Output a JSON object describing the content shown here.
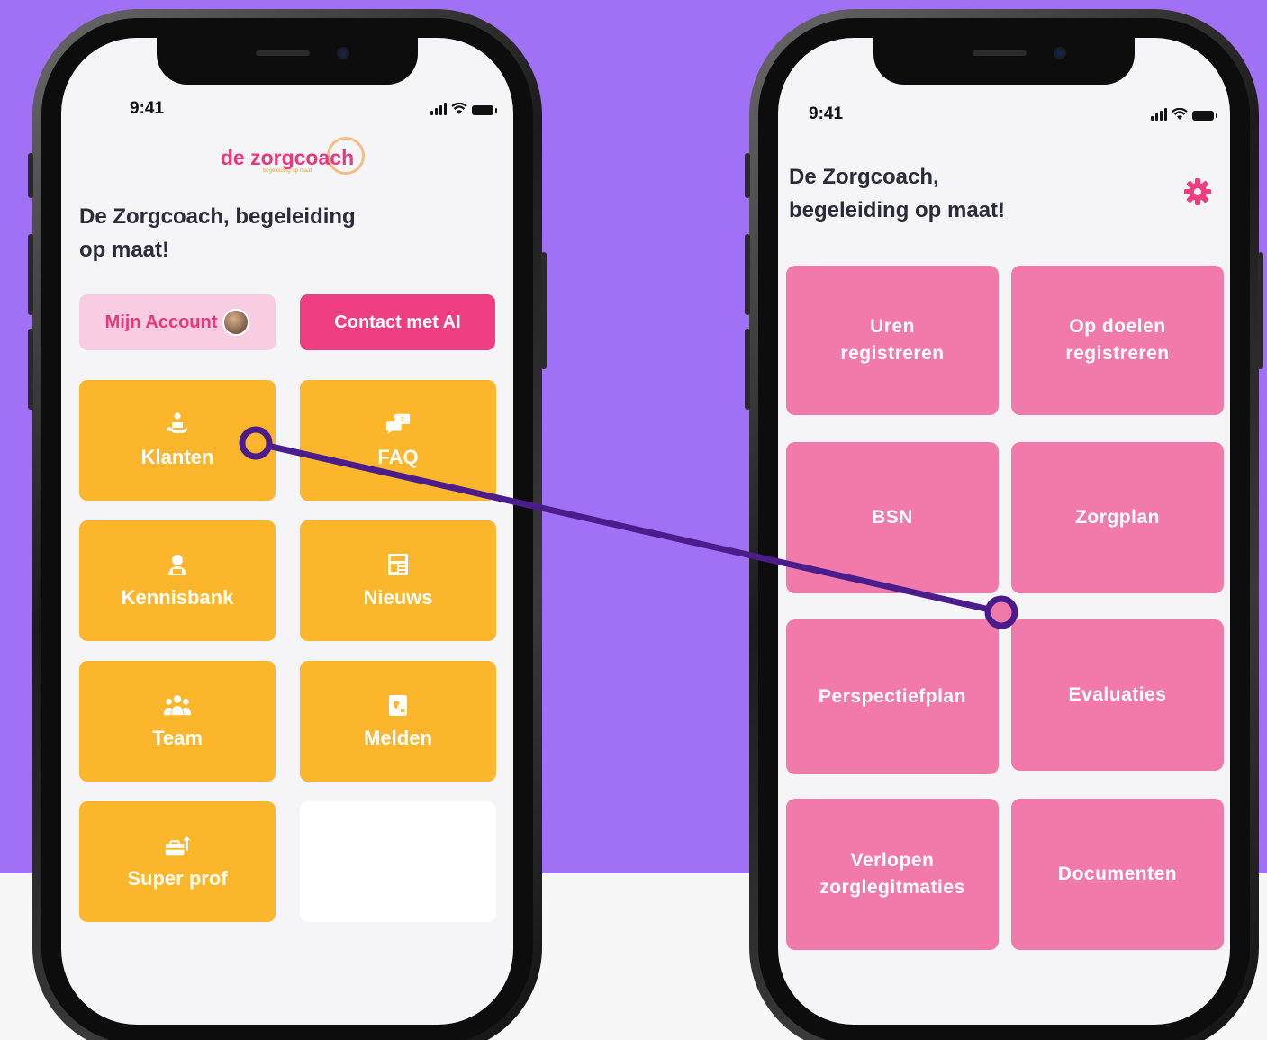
{
  "left_phone": {
    "status_time": "9:41",
    "logo": {
      "text": "de zorgcoach",
      "tagline": "begeleiding op maat"
    },
    "heading_line1": "De Zorgcoach, begeleiding",
    "heading_line2": "op maat!",
    "account_button": "Mijn Account",
    "contact_button": "Contact met AI",
    "tiles": [
      {
        "label": "Klanten",
        "icon": "caregiver-icon"
      },
      {
        "label": "FAQ",
        "icon": "chat-icon"
      },
      {
        "label": "Kennisbank",
        "icon": "knowledge-icon"
      },
      {
        "label": "Nieuws",
        "icon": "newspaper-icon"
      },
      {
        "label": "Team",
        "icon": "team-icon"
      },
      {
        "label": "Melden",
        "icon": "report-icon"
      },
      {
        "label": "Super prof",
        "icon": "briefcase-arrow-icon"
      }
    ]
  },
  "right_phone": {
    "status_time": "9:41",
    "heading_line1": "De Zorgcoach,",
    "heading_line2": "begeleiding op maat!",
    "settings_icon": "gear-icon",
    "tiles": [
      {
        "line1": "Uren",
        "line2": "registreren"
      },
      {
        "line1": "Op doelen",
        "line2": "registreren"
      },
      {
        "line1": "BSN",
        "line2": ""
      },
      {
        "line1": "Zorgplan",
        "line2": ""
      },
      {
        "line1": "Perspectiefplan",
        "line2": ""
      },
      {
        "line1": "Evaluaties",
        "line2": ""
      },
      {
        "line1": "Verlopen",
        "line2": "zorglegitmaties"
      },
      {
        "line1": "Documenten",
        "line2": ""
      }
    ]
  },
  "colors": {
    "background": "#a070f5",
    "orange_tile": "#fbb62c",
    "pink_tile": "#f27aab",
    "brand_pink": "#e8387b",
    "connector": "#4b1d8c"
  }
}
